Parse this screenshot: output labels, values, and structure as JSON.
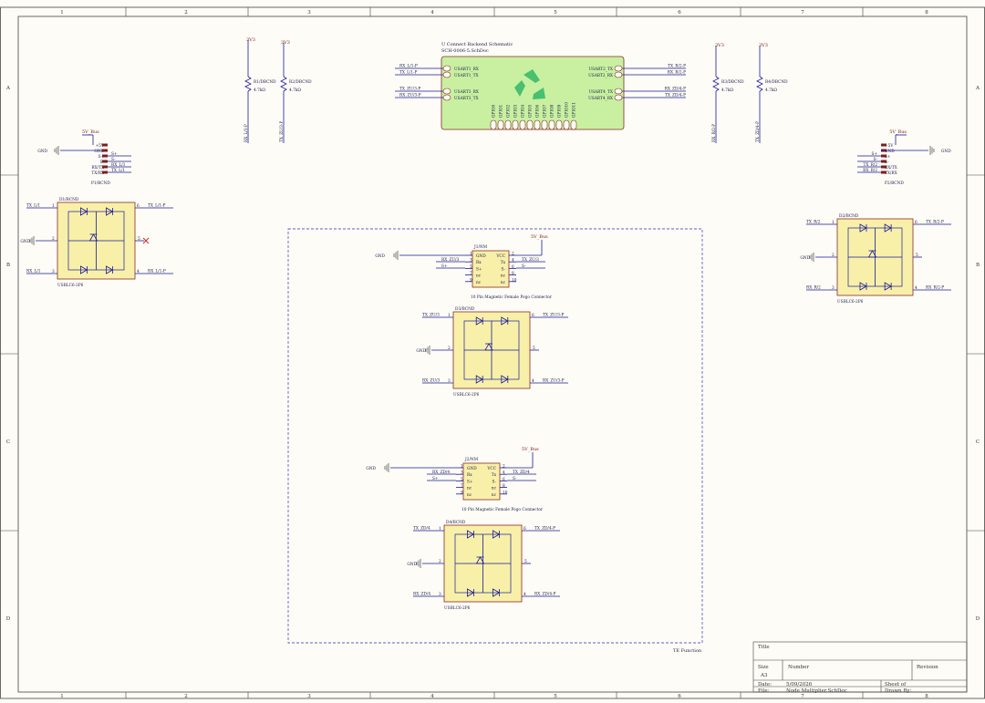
{
  "frame": {
    "columns": [
      "1",
      "2",
      "3",
      "4",
      "5",
      "6",
      "7",
      "8"
    ],
    "rows": [
      "A",
      "B",
      "C",
      "D"
    ]
  },
  "title_block": {
    "title_label": "Title",
    "size_label": "Size",
    "size_value": "A3",
    "number_label": "Number",
    "revision_label": "Revision",
    "date_label": "Date:",
    "date_value": "5/09/2026",
    "file_label": "File:",
    "file_value": "Node Multiplier.SchDoc",
    "sheet_label": "Sheet   of",
    "drawn_label": "Drawn By:"
  },
  "sheet_symbol": {
    "designator": "U  Connect Backend Schematic",
    "filename": "SCH-0006-5.SchDoc",
    "left_ports": [
      "USART1_RX",
      "USART1_TX",
      "USART3_RX",
      "USART3_TX"
    ],
    "right_ports": [
      "USART2_TX",
      "USART2_RX",
      "USART4_TX",
      "USART4_RX"
    ],
    "bottom_ports": [
      "GPIO0",
      "GPIO1",
      "GPIO2",
      "GPIO3",
      "GPIO4",
      "GPIO5",
      "GPIO6",
      "GPIO7",
      "GPIO8",
      "GPIO9",
      "GPIO10",
      "GPIO11"
    ],
    "left_nets": [
      "RX_L/1-P",
      "TX_L/1-P",
      "TX_ZU/3-P",
      "RX_ZU/3-P"
    ],
    "right_nets": [
      "TX_R/2-P",
      "RX_R/2-P",
      "RX_ZD/4-P",
      "TX_ZD/4-P"
    ]
  },
  "supplies": {
    "v3": "3V3",
    "v5": "5V_Bus",
    "gnd": "GND"
  },
  "resistors": [
    {
      "ref": "R1/DBCND",
      "value": "4.7kΩ",
      "net": "RX_L/1-P"
    },
    {
      "ref": "R2/DBCND",
      "value": "4.7kΩ",
      "net": "TX_ZU/3-P"
    },
    {
      "ref": "R3/DBCND",
      "value": "4.7kΩ",
      "net": "RX_R/2-P"
    },
    {
      "ref": "R4/DBCND",
      "value": "4.7kΩ",
      "net": "TX_ZD/4-P"
    }
  ],
  "connectors": {
    "p1": {
      "ref": "P1/BCND",
      "pins": [
        "+5V",
        "GND",
        "S+",
        "S-",
        "RX/TX",
        "TX/RX"
      ],
      "nets": [
        "S+",
        "S-",
        "RX_L/1",
        "TX_L/1"
      ]
    },
    "p2": {
      "ref": "P2/BCND",
      "pins": [
        "+5V",
        "GND",
        "S+",
        "S-",
        "RX/TX",
        "TX/RX"
      ],
      "nets": [
        "S+",
        "S-",
        "TX_R/2",
        "RX_R/2"
      ]
    },
    "j1": {
      "ref": "J1/NM",
      "pins_left": [
        "GND",
        "Rx",
        "S+",
        "nc",
        "nc"
      ],
      "pins_right": [
        "VCC",
        "Tx",
        "S-",
        "nc",
        "nc"
      ],
      "nets": [
        "RX_ZU/3",
        "S+",
        "TX_ZU/3",
        "S-"
      ],
      "caption": "10 Pin Magnetic Female Pogo Connector"
    },
    "j2": {
      "ref": "J2/NM",
      "pins_left": [
        "GND",
        "Rx",
        "S+",
        "nc",
        "nc"
      ],
      "pins_right": [
        "VCC",
        "Tx",
        "S-",
        "nc",
        "nc"
      ],
      "nets": [
        "RX_ZD/4",
        "S+",
        "TX_ZD/4",
        "S-"
      ],
      "caption": "10 Pin Magnetic Female Pogo Connector"
    }
  },
  "tvs": [
    {
      "ref": "D1/BCND",
      "part": "USBLC6-2P6",
      "nets": [
        "TX_L/1",
        "TX_L/1-P",
        "RX_L/1",
        "RX_L/1-P"
      ]
    },
    {
      "ref": "D2/BCND",
      "part": "USBLC6-2P6",
      "nets": [
        "TX_R/2",
        "TX_R/2-P",
        "RX_R/2",
        "RX_R/2-P"
      ]
    },
    {
      "ref": "D3/BCND",
      "part": "USBLC6-2P6",
      "nets": [
        "TX_ZU/3",
        "TX_ZU/3-P",
        "RX_ZU/3",
        "RX_ZU/3-P"
      ]
    },
    {
      "ref": "D4/BCND",
      "part": "USBLC6-2P6",
      "nets": [
        "TX_ZD/4",
        "TX_ZD/4-P",
        "RX_ZD/4",
        "RX_ZD/4-P"
      ]
    }
  ],
  "region_label": "TE Function",
  "colors": {
    "wire": "#1a1a9c",
    "body": "#f8f0a8",
    "body_edge": "#8a2a2a",
    "sheet": "#c8f0a0",
    "frame": "#444444",
    "dashed": "#6060c8"
  }
}
